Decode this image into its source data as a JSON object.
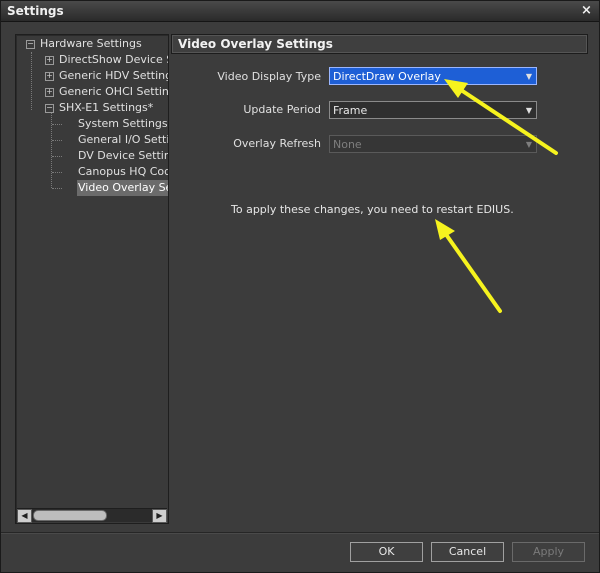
{
  "window": {
    "title": "Settings",
    "close_label": "×"
  },
  "tree": {
    "nodes": [
      {
        "label": "Hardware Settings",
        "expander": "−"
      },
      {
        "label": "DirectShow Device Settings",
        "expander": "+"
      },
      {
        "label": "Generic HDV Settings",
        "expander": "+"
      },
      {
        "label": "Generic OHCI Settings",
        "expander": "+"
      },
      {
        "label": "SHX-E1 Settings*",
        "expander": "−"
      },
      {
        "label": "System Settings"
      },
      {
        "label": "General I/O Settings"
      },
      {
        "label": "DV Device Settings"
      },
      {
        "label": "Canopus HQ Codec"
      },
      {
        "label": "Video Overlay Settings"
      }
    ],
    "scroll_left": "◀",
    "scroll_right": "▶"
  },
  "panel": {
    "title": "Video Overlay Settings",
    "fields": [
      {
        "label": "Video Display Type",
        "value": "DirectDraw Overlay"
      },
      {
        "label": "Update Period",
        "value": "Frame"
      },
      {
        "label": "Overlay Refresh",
        "value": "None"
      }
    ],
    "note": "To apply these changes, you need to restart EDIUS."
  },
  "buttons": {
    "ok": "OK",
    "cancel": "Cancel",
    "apply": "Apply"
  },
  "colors": {
    "highlight": "#1e5fd6",
    "annotation_arrow": "#f6f31e"
  }
}
